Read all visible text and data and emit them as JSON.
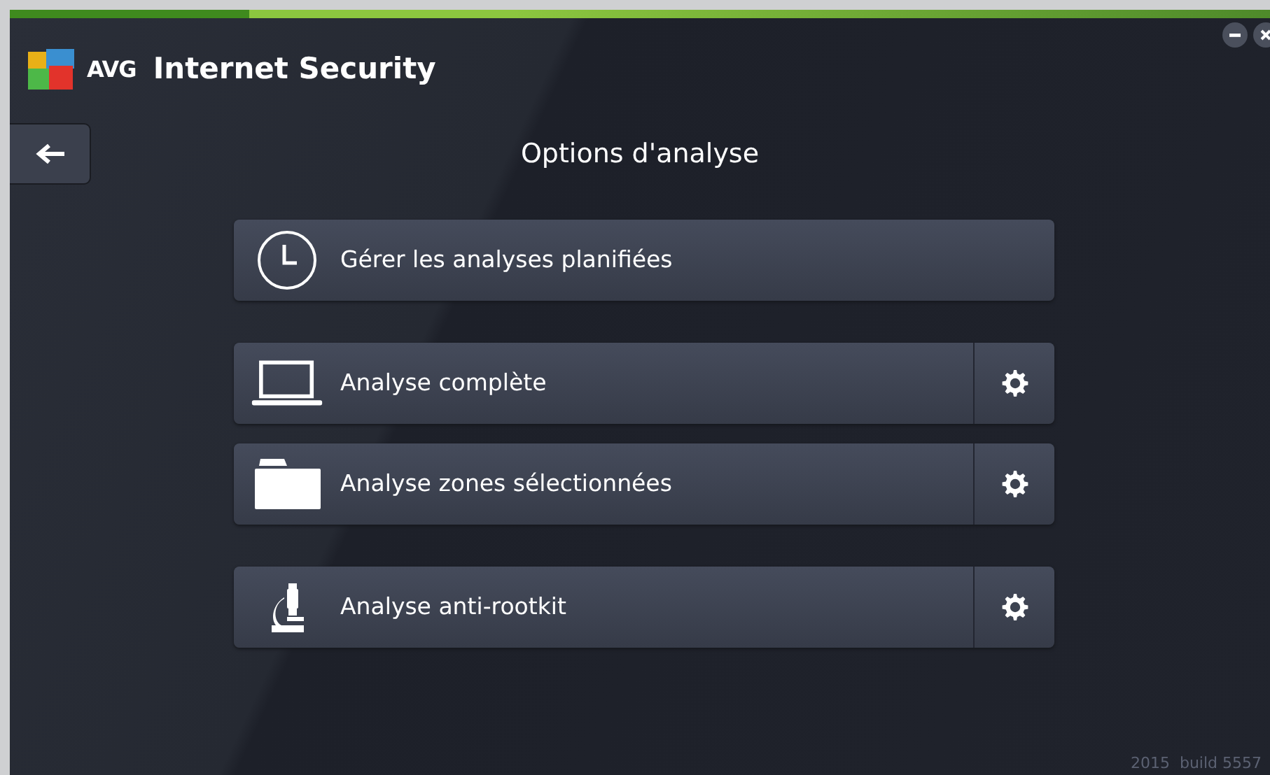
{
  "window": {
    "brand": "AVG",
    "title": "Internet Security"
  },
  "page_title": "Options d'analyse",
  "groups": [
    [
      {
        "kind": "clock",
        "label": "Gérer les analyses planifiées",
        "settings": false
      }
    ],
    [
      {
        "kind": "laptop",
        "label": "Analyse complète",
        "settings": true
      },
      {
        "kind": "folder",
        "label": "Analyse zones sélectionnées",
        "settings": true
      }
    ],
    [
      {
        "kind": "microscope",
        "label": "Analyse anti-rootkit",
        "settings": true
      }
    ]
  ],
  "footer": "2015  build 5557"
}
